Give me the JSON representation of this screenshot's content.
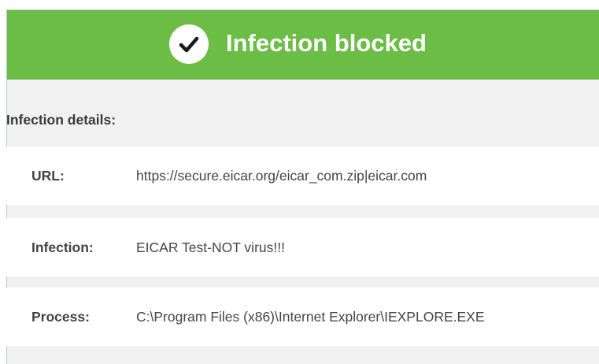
{
  "header": {
    "title": "Infection blocked",
    "icon": "checkmark-circle-icon",
    "background_color": "#6bbd45"
  },
  "details": {
    "section_label": "Infection details:",
    "rows": [
      {
        "label": "URL:",
        "value": "https://secure.eicar.org/eicar_com.zip|eicar.com"
      },
      {
        "label": "Infection:",
        "value": "EICAR Test-NOT virus!!!"
      },
      {
        "label": "Process:",
        "value": "C:\\Program Files (x86)\\Internet Explorer\\IEXPLORE.EXE"
      }
    ]
  }
}
